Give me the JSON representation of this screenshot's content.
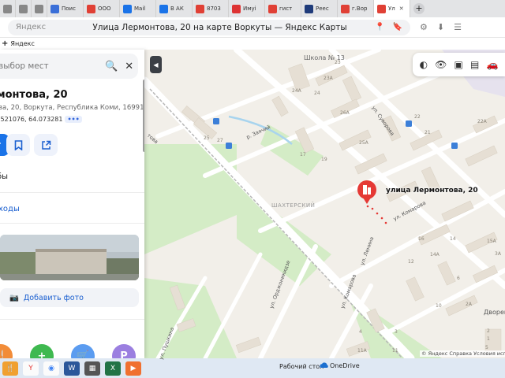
{
  "browser": {
    "tabs": [
      {
        "label": "",
        "favicon": "#888888",
        "icon": "generic-page-icon"
      },
      {
        "label": "",
        "favicon": "#888888",
        "icon": "generic-page-icon"
      },
      {
        "label": "",
        "favicon": "#888888",
        "icon": "generic-page-icon"
      },
      {
        "label": "Поис",
        "favicon": "#3a6fd8",
        "icon": "search-tab-icon"
      },
      {
        "label": "ООО",
        "favicon": "#e04035",
        "icon": "rbc-tab-icon"
      },
      {
        "label": "Mail",
        "favicon": "#1a73e8",
        "icon": "mail-tab-icon"
      },
      {
        "label": "В АК",
        "favicon": "#1a73e8",
        "icon": "mail-tab-icon"
      },
      {
        "label": "8703",
        "favicon": "#e04035",
        "icon": "rbc-tab-icon"
      },
      {
        "label": "Имуі",
        "favicon": "#d33",
        "icon": "news-tab-icon"
      },
      {
        "label": "гист",
        "favicon": "#e04035",
        "icon": "doc-tab-icon"
      },
      {
        "label": "Реес",
        "favicon": "#1f3b7a",
        "icon": "registry-tab-icon"
      },
      {
        "label": "г.Вор",
        "favicon": "#e04035",
        "icon": "doc-tab-icon"
      },
      {
        "label": "Ул",
        "favicon": "#e04035",
        "icon": "maps-tab-icon",
        "active": true
      }
    ],
    "close_label": "✕",
    "new_tab_label": "+",
    "address": {
      "site": "Яндекс",
      "title": "Улица Лермонтова, 20 на карте Воркуты — Яндекс Карты"
    },
    "bookmarks": {
      "plus": "+",
      "label": "Яндекс"
    }
  },
  "panel": {
    "search": {
      "placeholder": "выбор мест",
      "search_icon": "🔍",
      "close_icon": "✕"
    },
    "place": {
      "title": "монтова, 20",
      "address": "ва, 20, Воркута, Республика Коми, 169915",
      "coords": ".521076, 64.073281",
      "coords_more": "•••"
    },
    "section_label": "бы",
    "entrances_link": "ходы",
    "add_photo_label": "Добавить фото",
    "categories": [
      {
        "icon": "food-category-icon",
        "color": "#f28c38",
        "glyph": "🍴"
      },
      {
        "icon": "pharmacy-category-icon",
        "color": "#3fb950",
        "glyph": "+"
      },
      {
        "icon": "shop-category-icon",
        "color": "#5b9cf0",
        "glyph": "🛒"
      },
      {
        "icon": "parking-category-icon",
        "color": "#9b7fe0",
        "glyph": "P"
      }
    ]
  },
  "map": {
    "collapse_label": "◀",
    "school_label": "Школа № 13",
    "marker_label": "улица Лермонтова, 20",
    "district_label": "ШАХТЕРСКИЙ",
    "poi_label": "Дворец",
    "footer": "© Яндекс   Справка   Условия использ",
    "streets": {
      "suvorova": "ул. Суворова",
      "komarova": "ул. Комарова",
      "komarova2": "ул. Комарова",
      "zheleznaya": "р. Заячий",
      "tova": "това",
      "ordzhonikidze": "ул. Орджоникидзе",
      "lenina": "ул. Ленина",
      "pushkina": "ул. Пушкина"
    },
    "house_numbers": [
      "23А",
      "23",
      "24А",
      "24",
      "26А",
      "25",
      "25А",
      "22",
      "22А",
      "21",
      "17",
      "19",
      "16",
      "14",
      "14А",
      "12",
      "11А",
      "11",
      "10",
      "6",
      "15А",
      "3А",
      "2",
      "1",
      "5",
      "4",
      "3",
      "2А",
      "27"
    ],
    "layer_icons": [
      "layers-icon",
      "panorama-icon",
      "bus-icon",
      "transport-icon",
      "car-icon"
    ],
    "colors": {
      "park": "#cdeac0",
      "road": "#ffffff",
      "building": "#e6dfd4",
      "bg": "#f2efe9",
      "marker": "#e53935"
    }
  },
  "taskbar": {
    "desktop_label": "Рабочий стол",
    "onedrive_label": "OneDrive",
    "apps": [
      {
        "icon": "cartoon-app-icon",
        "color": "#f0a030"
      },
      {
        "icon": "yandex-browser-icon",
        "color": "#fbfbfb"
      },
      {
        "icon": "chrome-icon",
        "color": "#fbfbfb"
      },
      {
        "icon": "word-icon",
        "color": "#2b579a"
      },
      {
        "icon": "calculator-icon",
        "color": "#555"
      },
      {
        "icon": "excel-icon",
        "color": "#217346"
      },
      {
        "icon": "browser-app-icon",
        "color": "#f07030"
      }
    ]
  }
}
